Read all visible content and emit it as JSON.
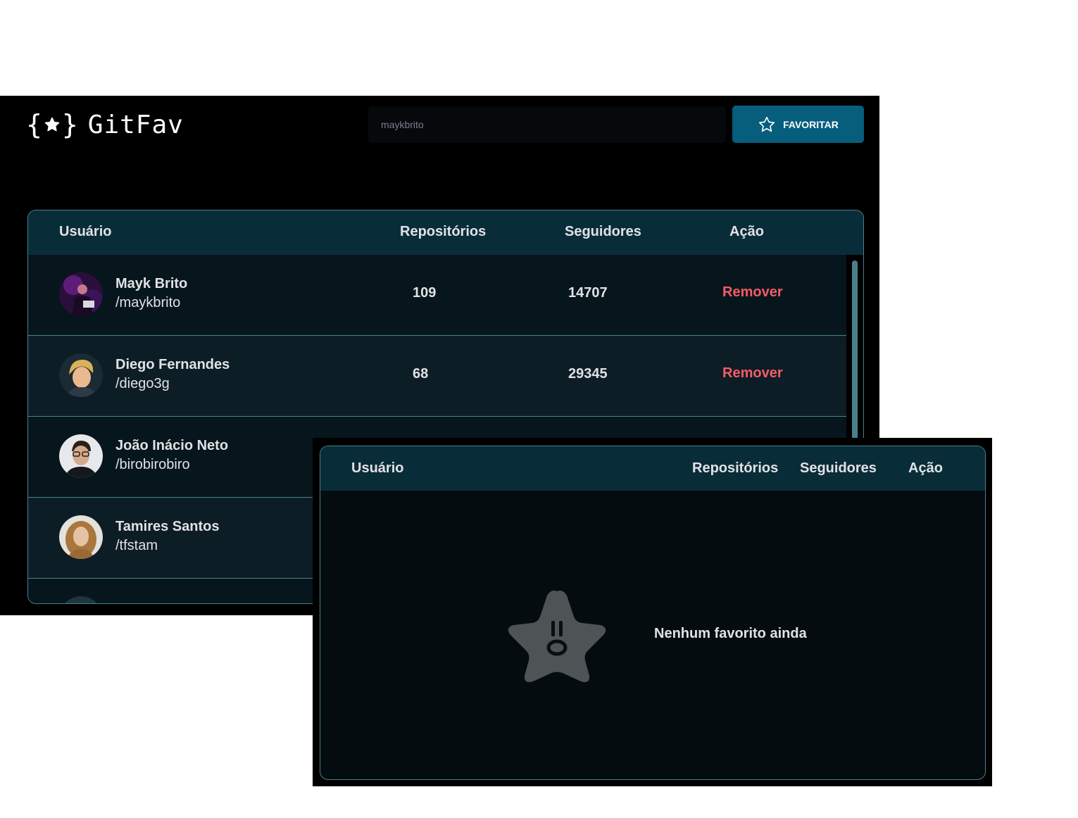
{
  "header": {
    "logo_brace_open": "{",
    "logo_brace_close": "}",
    "logo_icon": "star-icon",
    "app_name": "GitFav"
  },
  "search": {
    "placeholder": "maykbrito"
  },
  "favorite_button": {
    "icon": "star-outline-icon",
    "label": "FAVORITAR"
  },
  "table": {
    "columns": [
      "Usuário",
      "Repositórios",
      "Seguidores",
      "Ação"
    ],
    "rows": [
      {
        "name": "Mayk Brito",
        "login": "/maykbrito",
        "repositories": "109",
        "followers": "14707",
        "action": "Remover"
      },
      {
        "name": "Diego Fernandes",
        "login": "/diego3g",
        "repositories": "68",
        "followers": "29345",
        "action": "Remover"
      },
      {
        "name": "João Inácio Neto",
        "login": "/birobirobiro"
      },
      {
        "name": "Tamires Santos",
        "login": "/tfstam"
      }
    ]
  },
  "empty_state": {
    "columns": [
      "Usuário",
      "Repositórios",
      "Seguidores",
      "Ação"
    ],
    "icon": "sad-star-icon",
    "message": "Nenhum favorito ainda"
  },
  "colors": {
    "accent": "#065e7c",
    "remove": "#f75a68",
    "header_bg": "#092d38",
    "border": "#4a808c"
  }
}
